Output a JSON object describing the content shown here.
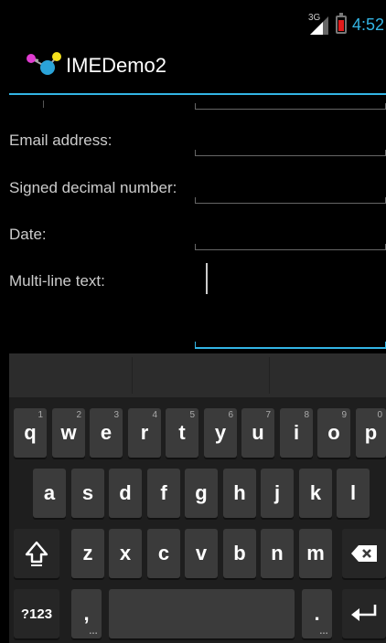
{
  "status_bar": {
    "network_type": "3G",
    "time": "4:52",
    "battery_level": 0.3
  },
  "action_bar": {
    "title": "IMEDemo2",
    "accent_color": "#33b5e5"
  },
  "form": {
    "rows": [
      {
        "label": "Email address:",
        "value": ""
      },
      {
        "label": "Signed decimal number:",
        "value": ""
      },
      {
        "label": "Date:",
        "value": ""
      },
      {
        "label": "Multi-line text:",
        "value": ""
      }
    ]
  },
  "keyboard": {
    "row1": [
      {
        "key": "q",
        "hint": "1"
      },
      {
        "key": "w",
        "hint": "2"
      },
      {
        "key": "e",
        "hint": "3"
      },
      {
        "key": "r",
        "hint": "4"
      },
      {
        "key": "t",
        "hint": "5"
      },
      {
        "key": "y",
        "hint": "6"
      },
      {
        "key": "u",
        "hint": "7"
      },
      {
        "key": "i",
        "hint": "8"
      },
      {
        "key": "o",
        "hint": "9"
      },
      {
        "key": "p",
        "hint": "0"
      }
    ],
    "row2": [
      "a",
      "s",
      "d",
      "f",
      "g",
      "h",
      "j",
      "k",
      "l"
    ],
    "row3": [
      "z",
      "x",
      "c",
      "v",
      "b",
      "n",
      "m"
    ],
    "symbols_key": "?123",
    "comma_key": ",",
    "period_key": ".",
    "sub_hint": "…",
    "shift_icon": "shift-arrow-icon",
    "backspace_icon": "backspace-icon",
    "enter_icon": "enter-icon"
  }
}
